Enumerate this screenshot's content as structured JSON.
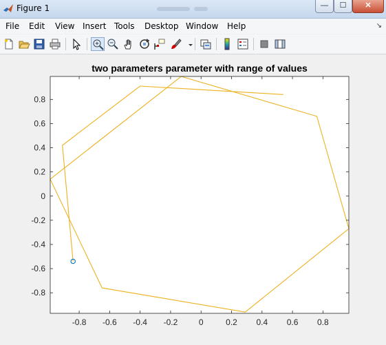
{
  "window": {
    "title": "Figure 1",
    "minimize": "—",
    "maximize": "☐",
    "close": "✕"
  },
  "menu": {
    "items": [
      "File",
      "Edit",
      "View",
      "Insert",
      "Tools",
      "Desktop",
      "Window",
      "Help"
    ],
    "overflow_arrow": "↘"
  },
  "toolbar": {
    "buttons": [
      {
        "icon": "new-figure-icon"
      },
      {
        "icon": "open-file-icon"
      },
      {
        "icon": "save-icon"
      },
      {
        "icon": "print-icon"
      },
      {
        "icon": "edit-plot-arrow-icon"
      },
      {
        "icon": "zoom-in-icon",
        "pressed": true
      },
      {
        "icon": "zoom-out-icon"
      },
      {
        "icon": "pan-hand-icon"
      },
      {
        "icon": "rotate-3d-icon"
      },
      {
        "icon": "data-cursor-icon"
      },
      {
        "icon": "brush-icon"
      },
      {
        "icon": "brush-dropdown-icon"
      },
      {
        "icon": "link-plot-icon"
      },
      {
        "icon": "colorbar-icon"
      },
      {
        "icon": "legend-icon"
      },
      {
        "icon": "hide-plot-tools-icon"
      },
      {
        "icon": "show-plot-tools-icon"
      }
    ]
  },
  "colors": {
    "line": "#EDB120",
    "marker": "#0072BD",
    "axes_bg": "#ffffff",
    "figure_bg": "#f0f0f0"
  },
  "chart_data": {
    "type": "line",
    "title": "two parameters parameter with range of values",
    "xlim": [
      -0.99,
      0.97
    ],
    "ylim": [
      -0.97,
      0.99
    ],
    "xticks": [
      -0.8,
      -0.6,
      -0.4,
      -0.2,
      0,
      0.2,
      0.4,
      0.6,
      0.8
    ],
    "xtick_labels": [
      "-0.8",
      "-0.6",
      "-0.4",
      "-0.2",
      "0",
      "0.2",
      "0.4",
      "0.6",
      "0.8"
    ],
    "yticks": [
      -0.8,
      -0.6,
      -0.4,
      -0.2,
      0,
      0.2,
      0.4,
      0.6,
      0.8
    ],
    "ytick_labels": [
      "-0.8",
      "-0.6",
      "-0.4",
      "-0.2",
      "0",
      "0.2",
      "0.4",
      "0.6",
      "0.8"
    ],
    "grid": false,
    "series": [
      {
        "x": [
          -0.84,
          -0.91,
          -0.4,
          0.54
        ],
        "y": [
          -0.54,
          0.42,
          0.91,
          0.84
        ]
      },
      {
        "x": [
          -0.13,
          0.76,
          0.97,
          0.29,
          -0.65,
          -0.99,
          -0.13
        ],
        "y": [
          0.99,
          0.66,
          -0.27,
          -0.96,
          -0.76,
          0.14,
          0.99
        ]
      }
    ],
    "start_marker": {
      "x": -0.84,
      "y": -0.54
    }
  }
}
